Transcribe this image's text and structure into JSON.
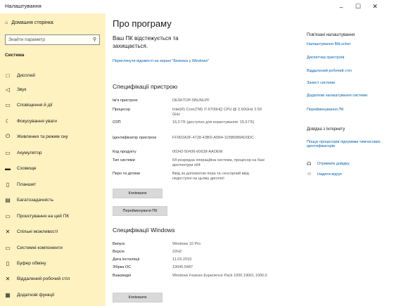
{
  "window": {
    "title": "Налаштування",
    "minimize": "–",
    "maximize": "☐",
    "close": "✕"
  },
  "sidebar": {
    "home": "Домашня сторінка",
    "search_placeholder": "Знайти параметр",
    "category": "Система",
    "items": [
      {
        "label": "Дисплей",
        "icon": "□"
      },
      {
        "label": "Звук",
        "icon": "◁"
      },
      {
        "label": "Сповіщення й дії",
        "icon": "▭"
      },
      {
        "label": "Фокусування уваги",
        "icon": "☾"
      },
      {
        "label": "Живлення та режим сну",
        "icon": "⏻"
      },
      {
        "label": "Акумулятор",
        "icon": "▭"
      },
      {
        "label": "Сховище",
        "icon": "▬"
      },
      {
        "label": "Планшет",
        "icon": "▯"
      },
      {
        "label": "Багатозадачність",
        "icon": "▤"
      },
      {
        "label": "Проєктування на цей ПК",
        "icon": "▭"
      },
      {
        "label": "Спільні можливості",
        "icon": "✕"
      },
      {
        "label": "Системні компоненти",
        "icon": "▭"
      },
      {
        "label": "Буфер обміну",
        "icon": "▯"
      },
      {
        "label": "Віддалений робочий стіл",
        "icon": "✕"
      },
      {
        "label": "Додаткові функції",
        "icon": "▦"
      }
    ]
  },
  "main": {
    "title": "Про програму",
    "protection": "Ваш ПК відстежується та захищається.",
    "security_link": "Переглянути відомості на екрані \"Безпека у Windows\"",
    "device_specs_title": "Специфікації пристрою",
    "device_specs": [
      {
        "key": "Ім'я пристрою",
        "value": "DESKTOP-5BUNLPF"
      },
      {
        "key": "Процесор",
        "value": "Intel(R) Core(TM) i7-6700HQ CPU @ 2.60GHz   2.59 GHz"
      },
      {
        "key": "ОЗП",
        "value": "16,0 ГБ (доступно для користування: 15,9 ГБ)"
      },
      {
        "key": "Ідентифікатор пристрою",
        "value": "FF9D2A3F-4728-43BD-A5B4-1D5B6B8AD0DC"
      },
      {
        "key": "Код продукту",
        "value": "00342-50436-60638-AAOEM"
      },
      {
        "key": "Тип системи",
        "value": "64-розрядна операційна система, процесор на базі архітектури x64"
      },
      {
        "key": "Перо та дотики",
        "value": "Ввід за допомогою пера та сенсорний ввід недоступні на цьому дисплеї"
      }
    ],
    "copy_button": "Копіювати",
    "rename_button": "Перейменувати ПК",
    "windows_specs_title": "Специфікації Windows",
    "windows_specs": [
      {
        "key": "Випуск",
        "value": "Windows 10 Pro"
      },
      {
        "key": "Версія",
        "value": "22H2"
      },
      {
        "key": "Дата інсталяції",
        "value": "11.03.2019"
      },
      {
        "key": "Збірка ОС",
        "value": "19045.5487"
      },
      {
        "key": "Взаємодія",
        "value": "Windows Feature Experience Pack 1000.19061.1000.0"
      }
    ],
    "copy_button_2": "Копіювати"
  },
  "related": {
    "title": "Пов'язані налаштування",
    "links": [
      "Налаштування BitLocker",
      "Диспетчер пристроїв",
      "Віддалений робочий стіл",
      "Захист системи",
      "Додаткові налаштування системи",
      "Перейменування ПК"
    ],
    "web_title": "Довідка з Інтернету",
    "web_link": "Пошук процесорів підтримки тимчасових ідентифікаторів",
    "help": [
      {
        "label": "Отримати довідку",
        "icon": "☊"
      },
      {
        "label": "Надати відгук",
        "icon": "☺"
      }
    ]
  }
}
